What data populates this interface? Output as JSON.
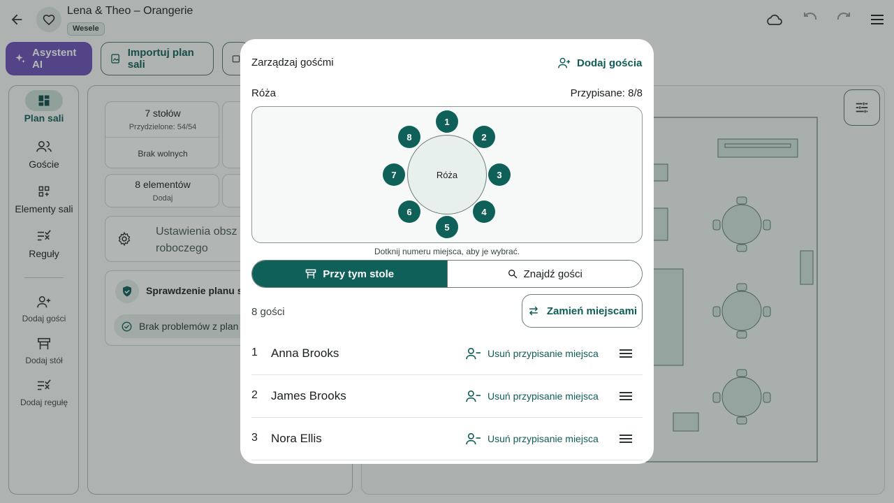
{
  "app": {
    "title": "Lena & Theo – Orangerie",
    "chip": "Wesele"
  },
  "toolbar": {
    "ai_label": "Asystent AI",
    "import_label": "Importuj plan sali"
  },
  "rail": {
    "items": [
      {
        "label": "Plan sali"
      },
      {
        "label": "Goście"
      },
      {
        "label": "Elementy sali"
      },
      {
        "label": "Reguły"
      },
      {
        "label": "Dodaj gości"
      },
      {
        "label": "Dodaj stół"
      },
      {
        "label": "Dodaj regułę"
      }
    ]
  },
  "panel": {
    "tables_title": "7 stołów",
    "tables_sub": "Przydzielone: 54/54",
    "tables_foot": "Brak wolnych",
    "elements_title": "8 elementów",
    "elements_sub": "Dodaj",
    "settings_text": "Ustawienia obsz roboczego",
    "check_title": "Sprawdzenie planu sa",
    "check_status": "Brak problemów z plan"
  },
  "dialog": {
    "title": "Zarządzaj gośćmi",
    "add_guest": "Dodaj gościa",
    "table_name": "Róża",
    "assigned": "Przypisane: 8/8",
    "seat_hint": "Dotknij numeru miejsca, aby je wybrać.",
    "tab_at_table": "Przy tym stole",
    "tab_find": "Znajdź gości",
    "guest_count": "8 gości",
    "swap": "Zamień miejscami",
    "seats": [
      "1",
      "2",
      "3",
      "4",
      "5",
      "6",
      "7",
      "8"
    ],
    "unassign_label": "Usuń przypisanie miejsca",
    "guests": [
      {
        "num": "1",
        "name": "Anna Brooks"
      },
      {
        "num": "2",
        "name": "James Brooks"
      },
      {
        "num": "3",
        "name": "Nora Ellis"
      }
    ]
  },
  "colors": {
    "primary": "#0f6058",
    "ai": "#6b4fb8",
    "surface": "#ffffff"
  }
}
